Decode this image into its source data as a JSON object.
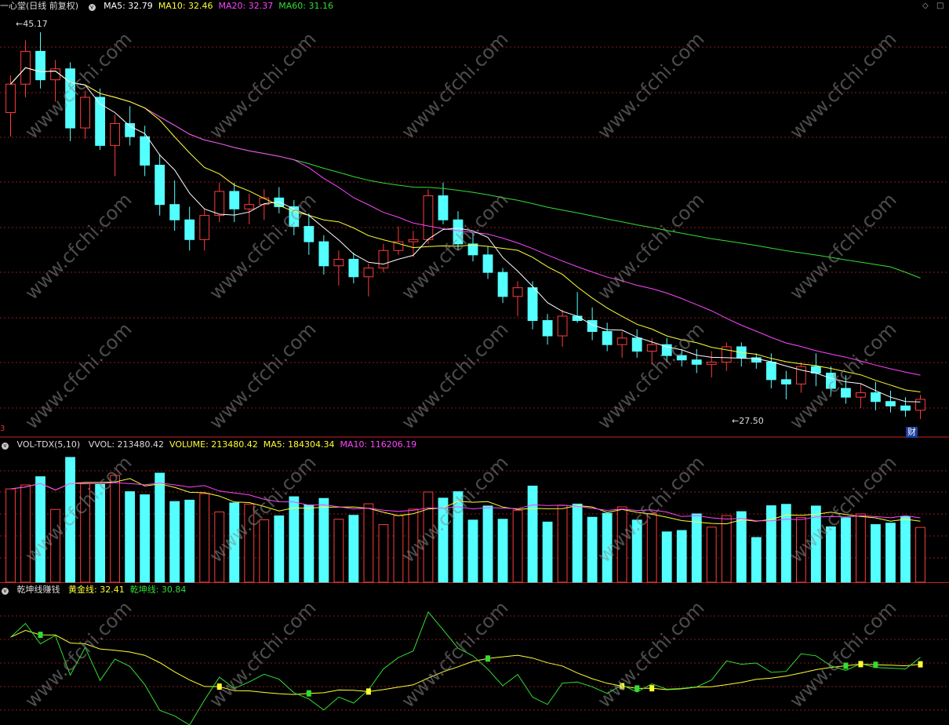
{
  "panels": {
    "price": {
      "indicator_name": "一心堂(日线 前复权)",
      "ma_labels": [
        {
          "label": "MA5: 32.79",
          "color": "#ffffff"
        },
        {
          "label": "MA10: 32.46",
          "color": "#ffff33"
        },
        {
          "label": "MA20: 32.37",
          "color": "#ff44ff"
        },
        {
          "label": "MA60: 31.16",
          "color": "#33dd33"
        }
      ],
      "max_label": "45.17",
      "min_label": "27.50",
      "finance_badge": "财",
      "corner_glyph": "3"
    },
    "volume": {
      "indicator_name": "VOL-TDX(5,10)",
      "labels": [
        {
          "label": "VVOL: 213480.42",
          "color": "#dcdcdc"
        },
        {
          "label": "VOLUME: 213480.42",
          "color": "#ffff33"
        },
        {
          "label": "MA5: 184304.34",
          "color": "#ffff33"
        },
        {
          "label": "MA10: 116206.19",
          "color": "#ff44ff"
        }
      ]
    },
    "osc": {
      "indicator_name": "乾坤线赚钱",
      "labels": [
        {
          "label": "黄金线: 32.41",
          "color": "#ffff33"
        },
        {
          "label": "乾坤线: 30.84",
          "color": "#33dd33"
        }
      ]
    }
  },
  "watermark": "www.cfchi.com",
  "colors": {
    "up": "#ff3c3c",
    "down": "#54ffff",
    "ma5": "#ffffff",
    "ma10": "#ffff33",
    "ma20": "#ff44ff",
    "ma60": "#33dd33",
    "grid": "#8b1a1a",
    "separator": "#cc2222"
  },
  "chart_data": [
    {
      "type": "candlestick",
      "title": "一心堂(日线 前复权)",
      "ylim": [
        27,
        46
      ],
      "max_marker": 45.17,
      "min_marker": 27.5,
      "ohlc": [
        [
          41.5,
          43.2,
          40.4,
          42.8
        ],
        [
          42.8,
          44.8,
          42.2,
          44.3
        ],
        [
          44.3,
          45.17,
          42.6,
          43.0
        ],
        [
          43.0,
          43.9,
          42.0,
          43.5
        ],
        [
          43.5,
          43.8,
          40.2,
          40.8
        ],
        [
          40.8,
          42.5,
          40.3,
          42.2
        ],
        [
          42.2,
          42.6,
          39.8,
          40.0
        ],
        [
          40.0,
          41.4,
          38.6,
          41.0
        ],
        [
          41.0,
          41.8,
          40.0,
          40.4
        ],
        [
          40.4,
          40.9,
          38.6,
          39.1
        ],
        [
          39.1,
          39.6,
          36.8,
          37.3
        ],
        [
          37.3,
          38.4,
          36.1,
          36.6
        ],
        [
          36.6,
          37.2,
          35.2,
          35.7
        ],
        [
          35.7,
          37.1,
          35.2,
          36.8
        ],
        [
          36.8,
          38.3,
          36.5,
          37.9
        ],
        [
          37.9,
          38.3,
          36.5,
          37.1
        ],
        [
          37.1,
          37.8,
          36.4,
          37.3
        ],
        [
          37.3,
          38.0,
          36.6,
          37.6
        ],
        [
          37.6,
          38.1,
          36.9,
          37.2
        ],
        [
          37.2,
          37.5,
          35.9,
          36.3
        ],
        [
          36.3,
          36.9,
          35.0,
          35.6
        ],
        [
          35.6,
          35.9,
          34.1,
          34.5
        ],
        [
          34.5,
          35.2,
          33.6,
          34.8
        ],
        [
          34.8,
          35.1,
          33.7,
          34.0
        ],
        [
          34.0,
          34.6,
          33.1,
          34.4
        ],
        [
          34.4,
          35.5,
          34.2,
          35.2
        ],
        [
          35.2,
          36.3,
          35.0,
          35.6
        ],
        [
          35.6,
          36.1,
          34.9,
          35.7
        ],
        [
          35.7,
          38.0,
          35.5,
          37.7
        ],
        [
          37.7,
          38.3,
          36.4,
          36.6
        ],
        [
          36.6,
          37.0,
          35.2,
          35.5
        ],
        [
          35.5,
          36.0,
          34.7,
          35.0
        ],
        [
          35.0,
          35.4,
          33.9,
          34.2
        ],
        [
          34.2,
          34.4,
          32.8,
          33.1
        ],
        [
          33.1,
          33.8,
          32.2,
          33.5
        ],
        [
          33.5,
          33.8,
          31.6,
          32.0
        ],
        [
          32.0,
          32.3,
          30.9,
          31.3
        ],
        [
          31.3,
          32.5,
          30.8,
          32.2
        ],
        [
          32.2,
          33.3,
          31.9,
          32.0
        ],
        [
          32.0,
          32.6,
          31.1,
          31.5
        ],
        [
          31.5,
          31.9,
          30.6,
          30.9
        ],
        [
          30.9,
          31.5,
          30.3,
          31.2
        ],
        [
          31.2,
          31.6,
          30.3,
          30.6
        ],
        [
          30.6,
          31.2,
          30.0,
          30.9
        ],
        [
          30.9,
          31.2,
          30.1,
          30.4
        ],
        [
          30.4,
          30.7,
          29.9,
          30.2
        ],
        [
          30.2,
          30.7,
          29.6,
          30.0
        ],
        [
          30.0,
          30.6,
          29.4,
          30.1
        ],
        [
          30.1,
          31.0,
          29.7,
          30.8
        ],
        [
          30.8,
          31.0,
          29.9,
          30.3
        ],
        [
          30.3,
          30.5,
          29.8,
          30.1
        ],
        [
          30.1,
          30.5,
          28.9,
          29.3
        ],
        [
          29.3,
          29.7,
          28.4,
          29.1
        ],
        [
          29.1,
          30.1,
          28.7,
          29.9
        ],
        [
          29.9,
          30.5,
          29.0,
          29.6
        ],
        [
          29.6,
          29.9,
          28.6,
          28.9
        ],
        [
          28.9,
          29.5,
          28.2,
          28.5
        ],
        [
          28.5,
          29.1,
          28.0,
          28.7
        ],
        [
          28.7,
          29.2,
          27.9,
          28.3
        ],
        [
          28.3,
          28.8,
          27.8,
          28.1
        ],
        [
          28.1,
          28.5,
          27.6,
          27.9
        ],
        [
          27.9,
          28.6,
          27.5,
          28.4
        ]
      ]
    }
  ]
}
